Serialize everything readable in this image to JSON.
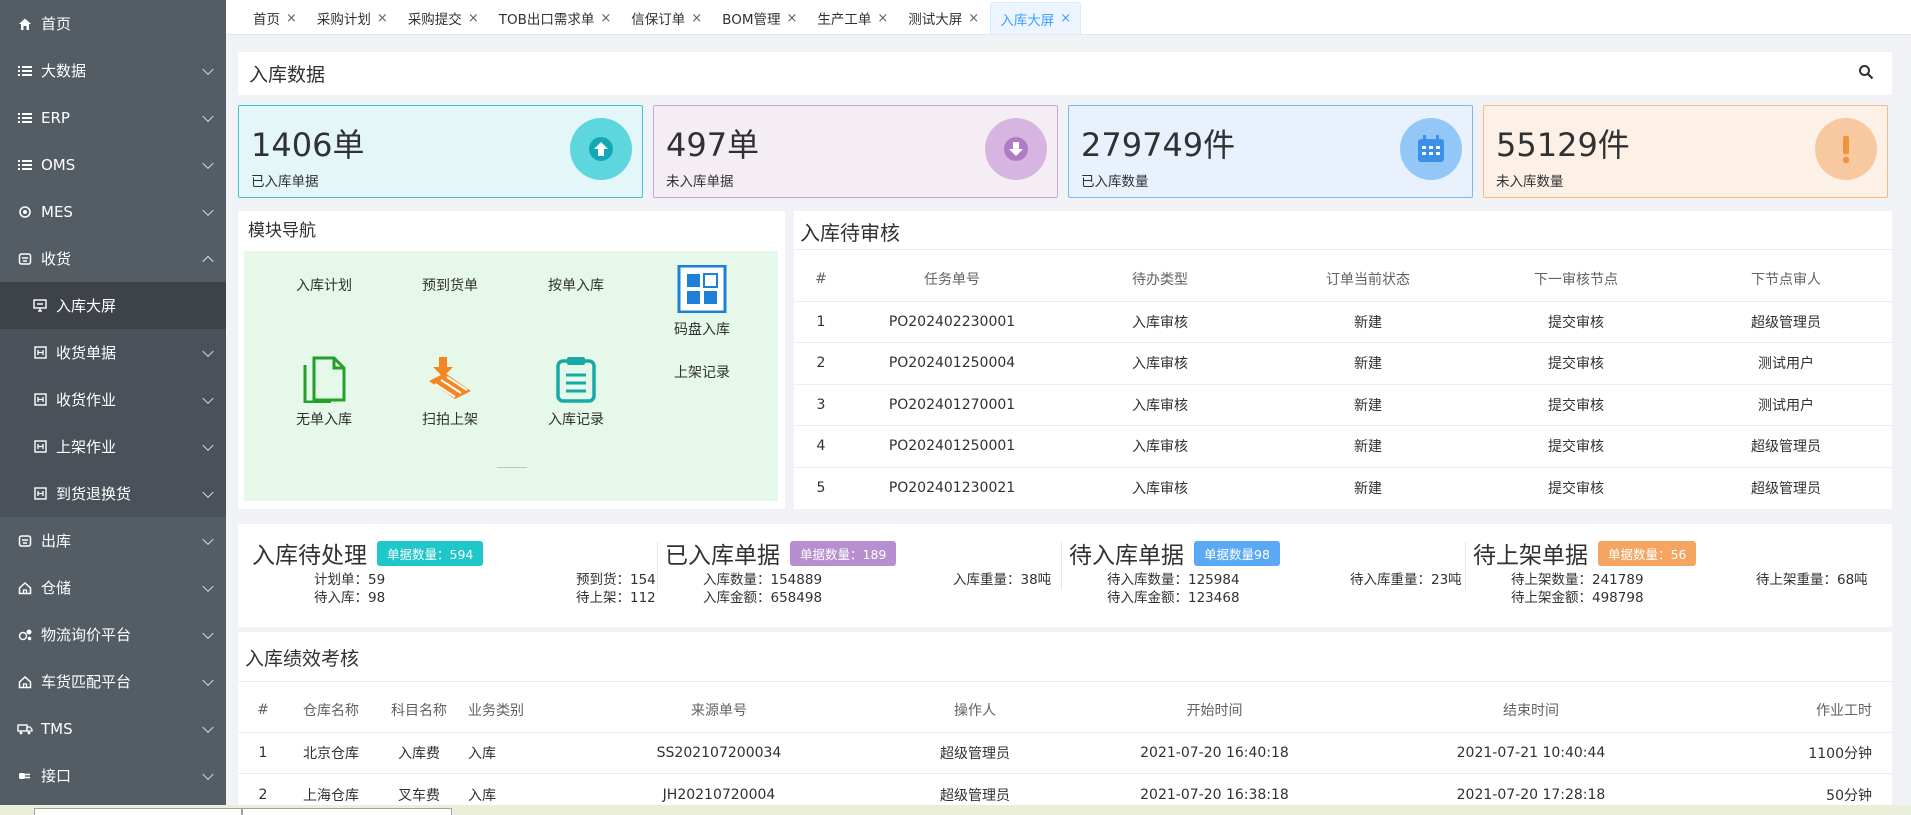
{
  "sidebar": {
    "items": [
      {
        "label": "首页",
        "icon": "home-icon",
        "chevron": false
      },
      {
        "label": "大数据",
        "icon": "list-icon",
        "chevron": true
      },
      {
        "label": "ERP",
        "icon": "list-icon",
        "chevron": true
      },
      {
        "label": "OMS",
        "icon": "list-icon",
        "chevron": true
      },
      {
        "label": "MES",
        "icon": "gear-icon",
        "chevron": true
      },
      {
        "label": "收货",
        "icon": "box-icon",
        "chevron": true,
        "expanded": true
      },
      {
        "label": "入库大屏",
        "icon": "monitor-icon",
        "sub": true,
        "active": true
      },
      {
        "label": "收货单据",
        "icon": "doc-icon",
        "sub": true,
        "chevron": true
      },
      {
        "label": "收货作业",
        "icon": "doc-icon",
        "sub": true,
        "chevron": true
      },
      {
        "label": "上架作业",
        "icon": "doc-icon",
        "sub": true,
        "chevron": true
      },
      {
        "label": "到货退换货",
        "icon": "doc-icon",
        "sub": true,
        "chevron": true
      },
      {
        "label": "出库",
        "icon": "box-icon",
        "chevron": true
      },
      {
        "label": "仓储",
        "icon": "home-outline-icon",
        "chevron": true
      },
      {
        "label": "物流询价平台",
        "icon": "gear-cluster-icon",
        "chevron": true
      },
      {
        "label": "车货匹配平台",
        "icon": "home-outline-icon",
        "chevron": true
      },
      {
        "label": "TMS",
        "icon": "truck-icon",
        "chevron": true
      },
      {
        "label": "接口",
        "icon": "plug-icon",
        "chevron": true
      }
    ]
  },
  "tabs": [
    {
      "label": "首页"
    },
    {
      "label": "采购计划"
    },
    {
      "label": "采购提交"
    },
    {
      "label": "TOB出口需求单"
    },
    {
      "label": "信保订单"
    },
    {
      "label": "BOM管理"
    },
    {
      "label": "生产工单"
    },
    {
      "label": "测试大屏"
    },
    {
      "label": "入库大屏",
      "active": true
    }
  ],
  "header": {
    "title": "入库数据"
  },
  "cards": [
    {
      "value": "1406单",
      "label": "已入库单据",
      "bg": "#e3f6f8",
      "border": "#3ec6cf",
      "circle": "#5dd6dd",
      "icon": "arrow-up-circle-icon"
    },
    {
      "value": "497单",
      "label": "未入库单据",
      "bg": "#f4eef4",
      "border": "#c9a9d3",
      "circle": "#d6b6e0",
      "icon": "arrow-down-circle-icon"
    },
    {
      "value": "279749件",
      "label": "已入库数量",
      "bg": "#e9f2fc",
      "border": "#7ab8f5",
      "circle": "#93c7f7",
      "icon": "calendar-icon"
    },
    {
      "value": "55129件",
      "label": "未入库数量",
      "bg": "#fdf1e7",
      "border": "#f5b98a",
      "circle": "#f8c8a0",
      "icon": "exclamation-icon"
    }
  ],
  "module_nav": {
    "title": "模块导航",
    "row1": [
      "入库计划",
      "预到货单",
      "按单入库",
      "码盘入库"
    ],
    "row2": [
      "无单入库",
      "扫拍上架",
      "入库记录"
    ],
    "extra": "上架记录"
  },
  "pending_review": {
    "title": "入库待审核",
    "columns": [
      "#",
      "任务单号",
      "待办类型",
      "订单当前状态",
      "下一审核节点",
      "下节点审人"
    ],
    "rows": [
      [
        "1",
        "PO202402230001",
        "入库审核",
        "新建",
        "提交审核",
        "超级管理员"
      ],
      [
        "2",
        "PO202401250004",
        "入库审核",
        "新建",
        "提交审核",
        "测试用户"
      ],
      [
        "3",
        "PO202401270001",
        "入库审核",
        "新建",
        "提交审核",
        "测试用户"
      ],
      [
        "4",
        "PO202401250001",
        "入库审核",
        "新建",
        "提交审核",
        "超级管理员"
      ],
      [
        "5",
        "PO202401230021",
        "入库审核",
        "新建",
        "提交审核",
        "超级管理员"
      ]
    ]
  },
  "summary": [
    {
      "title": "入库待处理",
      "badge": "单据数量：594",
      "badge_color": "#1fc8c8",
      "items": [
        "计划单：59",
        "预到货：154",
        "待入库：98",
        "待上架：112"
      ]
    },
    {
      "title": "已入库单据",
      "badge": "单据数量：189",
      "badge_color": "#b78fd0",
      "items": [
        "入库数量：154889",
        "入库重量：38吨",
        "入库金额：658498",
        ""
      ]
    },
    {
      "title": "待入库单据",
      "badge": "单据数量98",
      "badge_color": "#5aa9f5",
      "items": [
        "待入库数量：125984",
        "待入库重量：23吨",
        "待入库金额：123468",
        ""
      ]
    },
    {
      "title": "待上架单据",
      "badge": "单据数量：56",
      "badge_color": "#f5a462",
      "items": [
        "待上架数量：241789",
        "待上架重量：68吨",
        "待上架金额：498798",
        ""
      ]
    }
  ],
  "performance": {
    "title": "入库绩效考核",
    "columns": [
      "#",
      "仓库名称",
      "科目名称",
      "业务类别",
      "来源单号",
      "操作人",
      "开始时间",
      "结束时间",
      "作业工时"
    ],
    "rows": [
      [
        "1",
        "北京仓库",
        "入库费",
        "入库",
        "SS202107200034",
        "超级管理员",
        "2021-07-20 16:40:18",
        "2021-07-21 10:40:44",
        "1100分钟"
      ],
      [
        "2",
        "上海仓库",
        "叉车费",
        "入库",
        "JH20210720004",
        "超级管理员",
        "2021-07-20 16:38:18",
        "2021-07-20 17:28:18",
        "50分钟"
      ]
    ]
  }
}
